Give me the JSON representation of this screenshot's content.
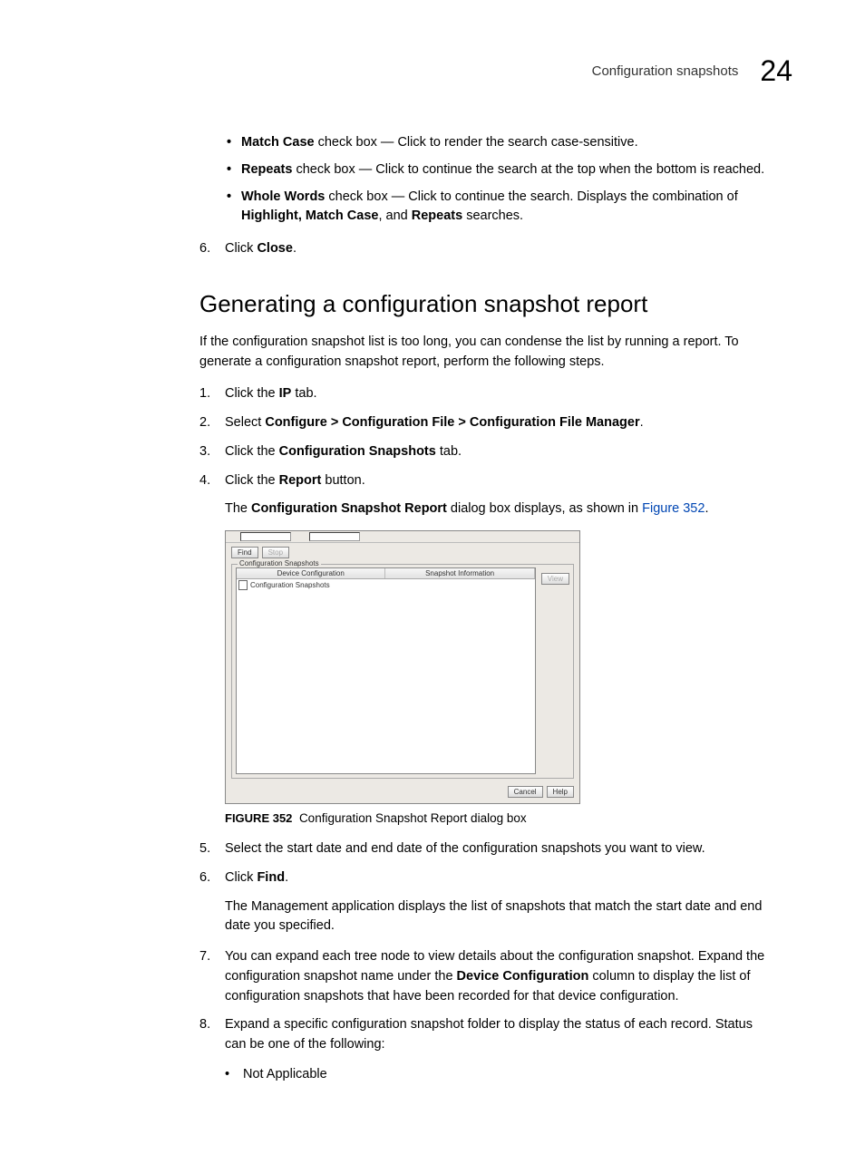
{
  "header": {
    "title": "Configuration snapshots",
    "chapter": "24"
  },
  "section1": {
    "bullets": [
      {
        "bold": "Match Case",
        "rest": " check box — Click to render the search case-sensitive."
      },
      {
        "bold": "Repeats",
        "rest": " check box — Click to continue the search at the top when the bottom is reached."
      },
      {
        "bold": "Whole Words",
        "rest": " check box — Click to continue the search. Displays the combination of ",
        "tail_bold": "Highlight, Match Case",
        "tail_mid": ", and ",
        "tail_bold2": "Repeats",
        "tail_end": " searches."
      }
    ],
    "step6": {
      "num": "6.",
      "pre": "Click ",
      "bold": "Close",
      "post": "."
    }
  },
  "heading2": "Generating a configuration snapshot report",
  "intro": "If the configuration snapshot list is too long, you can condense the list by running a report. To generate a configuration snapshot report, perform the following steps.",
  "steps": {
    "s1": {
      "num": "1.",
      "pre": "Click the ",
      "bold": "IP",
      "post": " tab."
    },
    "s2": {
      "num": "2.",
      "pre": "Select ",
      "bold": "Configure > Configuration File > Configuration File Manager",
      "post": "."
    },
    "s3": {
      "num": "3.",
      "pre": "Click the ",
      "bold": "Configuration Snapshots",
      "post": " tab."
    },
    "s4": {
      "num": "4.",
      "pre": "Click the ",
      "bold": "Report",
      "post": " button."
    },
    "s4_sub": {
      "pre": "The ",
      "bold": "Configuration Snapshot Report",
      "mid": " dialog box displays, as shown in ",
      "link": "Figure 352",
      "post": "."
    },
    "s5": {
      "num": "5.",
      "text": "Select the start date and end date of the configuration snapshots you want to view."
    },
    "s6": {
      "num": "6.",
      "pre": "Click ",
      "bold": "Find",
      "post": "."
    },
    "s6_sub": "The Management application displays the list of snapshots that match the start date and end date you specified.",
    "s7": {
      "num": "7.",
      "pre": "You can expand each tree node to view details about the configuration snapshot. Expand the configuration snapshot name under the ",
      "bold": "Device Configuration",
      "post": " column to display the list of configuration snapshots that have been recorded for that device configuration."
    },
    "s8": {
      "num": "8.",
      "text": "Expand a specific configuration snapshot folder to display the status of each record. Status can be one of the following:"
    },
    "s8_bullet": "Not Applicable"
  },
  "figure": {
    "label": "FIGURE 352",
    "caption": "Configuration Snapshot Report dialog box",
    "dialog": {
      "find_btn": "Find",
      "stop_btn": "Stop",
      "group_label": "Configuration Snapshots",
      "col1": "Device Configuration",
      "col2": "Snapshot Information",
      "row1": "Configuration Snapshots",
      "view_btn": "View",
      "cancel_btn": "Cancel",
      "help_btn": "Help"
    }
  }
}
